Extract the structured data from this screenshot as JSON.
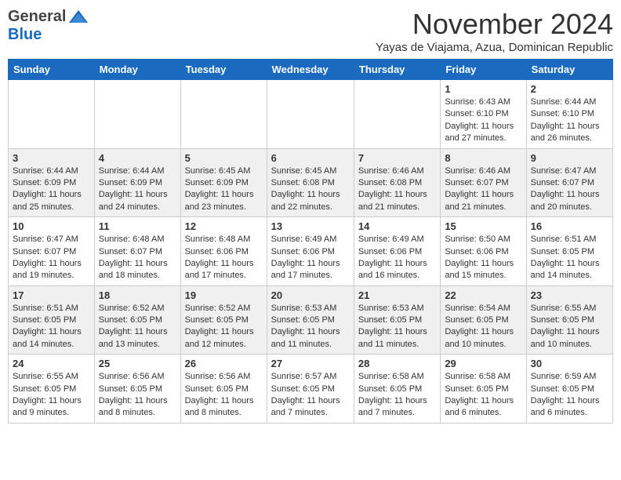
{
  "logo": {
    "general": "General",
    "blue": "Blue"
  },
  "title": "November 2024",
  "subtitle": "Yayas de Viajama, Azua, Dominican Republic",
  "days_of_week": [
    "Sunday",
    "Monday",
    "Tuesday",
    "Wednesday",
    "Thursday",
    "Friday",
    "Saturday"
  ],
  "weeks": [
    [
      {
        "day": "",
        "info": ""
      },
      {
        "day": "",
        "info": ""
      },
      {
        "day": "",
        "info": ""
      },
      {
        "day": "",
        "info": ""
      },
      {
        "day": "",
        "info": ""
      },
      {
        "day": "1",
        "info": "Sunrise: 6:43 AM\nSunset: 6:10 PM\nDaylight: 11 hours and 27 minutes."
      },
      {
        "day": "2",
        "info": "Sunrise: 6:44 AM\nSunset: 6:10 PM\nDaylight: 11 hours and 26 minutes."
      }
    ],
    [
      {
        "day": "3",
        "info": "Sunrise: 6:44 AM\nSunset: 6:09 PM\nDaylight: 11 hours and 25 minutes."
      },
      {
        "day": "4",
        "info": "Sunrise: 6:44 AM\nSunset: 6:09 PM\nDaylight: 11 hours and 24 minutes."
      },
      {
        "day": "5",
        "info": "Sunrise: 6:45 AM\nSunset: 6:09 PM\nDaylight: 11 hours and 23 minutes."
      },
      {
        "day": "6",
        "info": "Sunrise: 6:45 AM\nSunset: 6:08 PM\nDaylight: 11 hours and 22 minutes."
      },
      {
        "day": "7",
        "info": "Sunrise: 6:46 AM\nSunset: 6:08 PM\nDaylight: 11 hours and 21 minutes."
      },
      {
        "day": "8",
        "info": "Sunrise: 6:46 AM\nSunset: 6:07 PM\nDaylight: 11 hours and 21 minutes."
      },
      {
        "day": "9",
        "info": "Sunrise: 6:47 AM\nSunset: 6:07 PM\nDaylight: 11 hours and 20 minutes."
      }
    ],
    [
      {
        "day": "10",
        "info": "Sunrise: 6:47 AM\nSunset: 6:07 PM\nDaylight: 11 hours and 19 minutes."
      },
      {
        "day": "11",
        "info": "Sunrise: 6:48 AM\nSunset: 6:07 PM\nDaylight: 11 hours and 18 minutes."
      },
      {
        "day": "12",
        "info": "Sunrise: 6:48 AM\nSunset: 6:06 PM\nDaylight: 11 hours and 17 minutes."
      },
      {
        "day": "13",
        "info": "Sunrise: 6:49 AM\nSunset: 6:06 PM\nDaylight: 11 hours and 17 minutes."
      },
      {
        "day": "14",
        "info": "Sunrise: 6:49 AM\nSunset: 6:06 PM\nDaylight: 11 hours and 16 minutes."
      },
      {
        "day": "15",
        "info": "Sunrise: 6:50 AM\nSunset: 6:06 PM\nDaylight: 11 hours and 15 minutes."
      },
      {
        "day": "16",
        "info": "Sunrise: 6:51 AM\nSunset: 6:05 PM\nDaylight: 11 hours and 14 minutes."
      }
    ],
    [
      {
        "day": "17",
        "info": "Sunrise: 6:51 AM\nSunset: 6:05 PM\nDaylight: 11 hours and 14 minutes."
      },
      {
        "day": "18",
        "info": "Sunrise: 6:52 AM\nSunset: 6:05 PM\nDaylight: 11 hours and 13 minutes."
      },
      {
        "day": "19",
        "info": "Sunrise: 6:52 AM\nSunset: 6:05 PM\nDaylight: 11 hours and 12 minutes."
      },
      {
        "day": "20",
        "info": "Sunrise: 6:53 AM\nSunset: 6:05 PM\nDaylight: 11 hours and 11 minutes."
      },
      {
        "day": "21",
        "info": "Sunrise: 6:53 AM\nSunset: 6:05 PM\nDaylight: 11 hours and 11 minutes."
      },
      {
        "day": "22",
        "info": "Sunrise: 6:54 AM\nSunset: 6:05 PM\nDaylight: 11 hours and 10 minutes."
      },
      {
        "day": "23",
        "info": "Sunrise: 6:55 AM\nSunset: 6:05 PM\nDaylight: 11 hours and 10 minutes."
      }
    ],
    [
      {
        "day": "24",
        "info": "Sunrise: 6:55 AM\nSunset: 6:05 PM\nDaylight: 11 hours and 9 minutes."
      },
      {
        "day": "25",
        "info": "Sunrise: 6:56 AM\nSunset: 6:05 PM\nDaylight: 11 hours and 8 minutes."
      },
      {
        "day": "26",
        "info": "Sunrise: 6:56 AM\nSunset: 6:05 PM\nDaylight: 11 hours and 8 minutes."
      },
      {
        "day": "27",
        "info": "Sunrise: 6:57 AM\nSunset: 6:05 PM\nDaylight: 11 hours and 7 minutes."
      },
      {
        "day": "28",
        "info": "Sunrise: 6:58 AM\nSunset: 6:05 PM\nDaylight: 11 hours and 7 minutes."
      },
      {
        "day": "29",
        "info": "Sunrise: 6:58 AM\nSunset: 6:05 PM\nDaylight: 11 hours and 6 minutes."
      },
      {
        "day": "30",
        "info": "Sunrise: 6:59 AM\nSunset: 6:05 PM\nDaylight: 11 hours and 6 minutes."
      }
    ]
  ]
}
